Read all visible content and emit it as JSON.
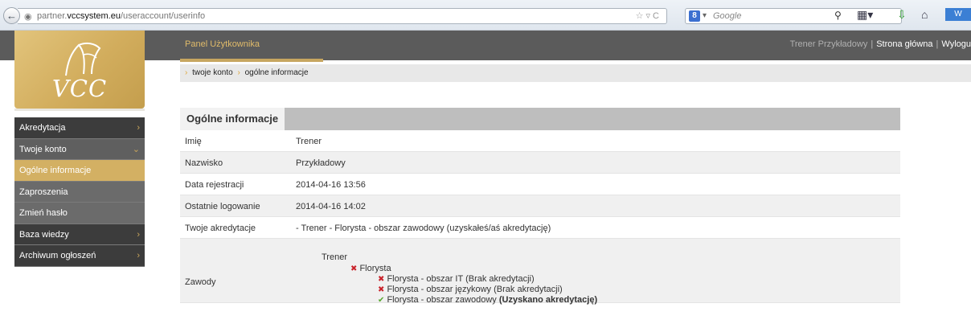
{
  "browser": {
    "url_prefix": "partner.",
    "url_domain": "vccsystem.eu",
    "url_path": "/useraccount/userinfo",
    "search_engine_glyph": "8",
    "search_placeholder": "Google"
  },
  "header": {
    "panel_title": "Panel Użytkownika",
    "user_name": "Trener Przykładowy",
    "sep1": "|",
    "home_link": "Strona główna",
    "sep2": "|",
    "logout_link": "Wylogu"
  },
  "logo": {
    "text": "VCC"
  },
  "sidebar": {
    "items": [
      {
        "label": "Akredytacja",
        "chevron": "›"
      },
      {
        "label": "Twoje konto",
        "chevron": "⌄"
      },
      {
        "label": "Ogólne informacje"
      },
      {
        "label": "Zaproszenia"
      },
      {
        "label": "Zmień hasło"
      },
      {
        "label": "Baza wiedzy",
        "chevron": "›"
      },
      {
        "label": "Archiwum ogłoszeń",
        "chevron": "›"
      }
    ]
  },
  "breadcrumb": {
    "items": [
      "twoje konto",
      "ogólne informacje"
    ]
  },
  "info": {
    "title": "Ogólne informacje",
    "rows": [
      {
        "label": "Imię",
        "value": "Trener"
      },
      {
        "label": "Nazwisko",
        "value": "Przykładowy"
      },
      {
        "label": "Data rejestracji",
        "value": "2014-04-16 13:56"
      },
      {
        "label": "Ostatnie logowanie",
        "value": "2014-04-16 14:02"
      },
      {
        "label": "Twoje akredytacje",
        "value": "- Trener - Florysta - obszar zawodowy (uzyskałeś/aś akredytację)"
      }
    ],
    "zawody": {
      "label": "Zawody",
      "root": "Trener",
      "profession": "Florysta",
      "areas": [
        {
          "name": "Florysta - obszar IT",
          "status": "(Brak akredytacji)",
          "ok": false
        },
        {
          "name": "Florysta - obszar językowy",
          "status": "(Brak akredytacji)",
          "ok": false
        },
        {
          "name": "Florysta - obszar zawodowy",
          "status": "(Uzyskano akredytację)",
          "ok": true
        }
      ]
    }
  }
}
